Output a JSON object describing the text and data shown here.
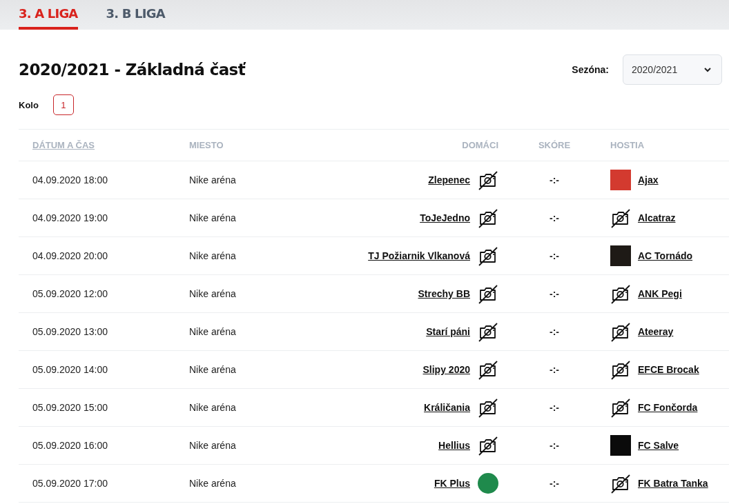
{
  "tabs": [
    {
      "label": "3. A LIGA",
      "selected": true
    },
    {
      "label": "3. B LIGA",
      "selected": false
    }
  ],
  "title": "2020/2021 - Základná časť",
  "season": {
    "label": "Sezóna:",
    "value": "2020/2021"
  },
  "rounds": {
    "label": "Kolo",
    "items": [
      {
        "label": "1",
        "selected": true
      }
    ]
  },
  "table": {
    "columns": [
      "DÁTUM A ČAS",
      "MIESTO",
      "DOMÁCI",
      "SKÓRE",
      "HOSTIA"
    ],
    "rows": [
      {
        "datetime": "04.09.2020 18:00",
        "venue": "Nike aréna",
        "home": "Zlepenec",
        "home_logo": {
          "kind": "none"
        },
        "score": "-:-",
        "away": "Ajax",
        "away_logo": {
          "kind": "image",
          "color": "#d33a2f"
        }
      },
      {
        "datetime": "04.09.2020 19:00",
        "venue": "Nike aréna",
        "home": "ToJeJedno",
        "home_logo": {
          "kind": "none"
        },
        "score": "-:-",
        "away": "Alcatraz",
        "away_logo": {
          "kind": "none"
        }
      },
      {
        "datetime": "04.09.2020 20:00",
        "venue": "Nike aréna",
        "home": "TJ Požiarnik Vlkanová",
        "home_logo": {
          "kind": "none"
        },
        "score": "-:-",
        "away": "AC Tornádo",
        "away_logo": {
          "kind": "image",
          "color": "#1e1a16"
        }
      },
      {
        "datetime": "05.09.2020 12:00",
        "venue": "Nike aréna",
        "home": "Strechy BB",
        "home_logo": {
          "kind": "none"
        },
        "score": "-:-",
        "away": "ANK Pegi",
        "away_logo": {
          "kind": "none"
        }
      },
      {
        "datetime": "05.09.2020 13:00",
        "venue": "Nike aréna",
        "home": "Starí páni",
        "home_logo": {
          "kind": "none"
        },
        "score": "-:-",
        "away": "Ateeray",
        "away_logo": {
          "kind": "none"
        }
      },
      {
        "datetime": "05.09.2020 14:00",
        "venue": "Nike aréna",
        "home": "Slipy 2020",
        "home_logo": {
          "kind": "none"
        },
        "score": "-:-",
        "away": "EFCE Brocak",
        "away_logo": {
          "kind": "none"
        }
      },
      {
        "datetime": "05.09.2020 15:00",
        "venue": "Nike aréna",
        "home": "Králičania",
        "home_logo": {
          "kind": "none"
        },
        "score": "-:-",
        "away": "FC Fončorda",
        "away_logo": {
          "kind": "none"
        }
      },
      {
        "datetime": "05.09.2020 16:00",
        "venue": "Nike aréna",
        "home": "Hellius",
        "home_logo": {
          "kind": "none"
        },
        "score": "-:-",
        "away": "FC Salve",
        "away_logo": {
          "kind": "image",
          "color": "#0b0b0b"
        }
      },
      {
        "datetime": "05.09.2020 17:00",
        "venue": "Nike aréna",
        "home": "FK Plus",
        "home_logo": {
          "kind": "round",
          "color": "#1f8a4c"
        },
        "score": "-:-",
        "away": "FK Batra Tanka",
        "away_logo": {
          "kind": "none"
        }
      }
    ]
  }
}
